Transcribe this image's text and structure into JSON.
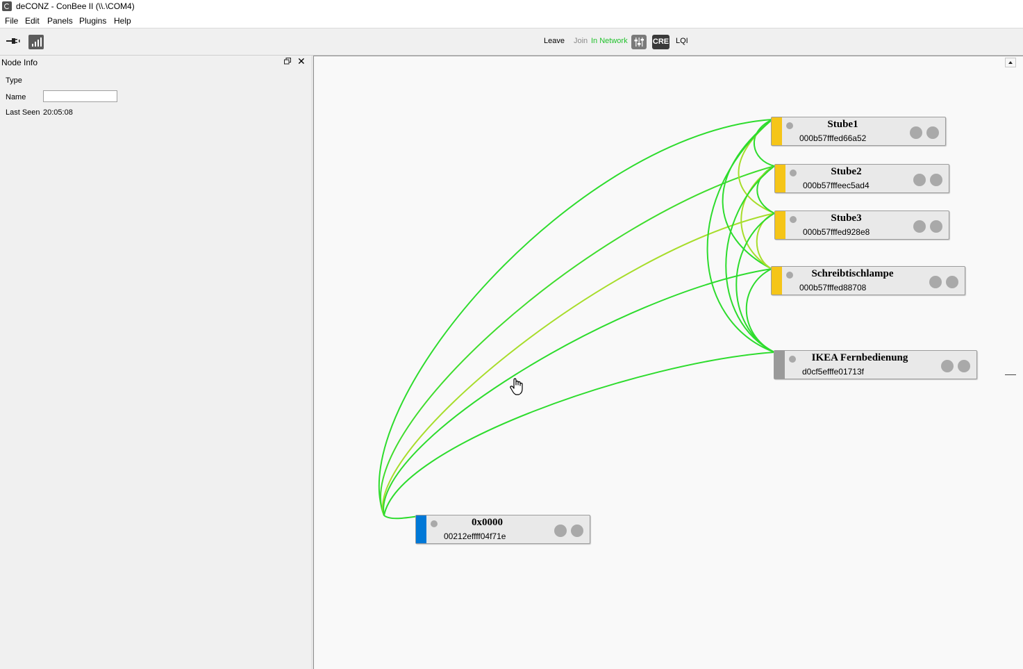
{
  "window": {
    "title": "deCONZ - ConBee II (\\\\.\\COM4)"
  },
  "menu": {
    "file": "File",
    "edit": "Edit",
    "panels": "Panels",
    "plugins": "Plugins",
    "help": "Help"
  },
  "toolbar": {
    "leave": "Leave",
    "join": "Join",
    "in_network": "In Network",
    "cre": "CRE",
    "lqi": "LQI",
    "icons": [
      "plug-icon",
      "signal-icon",
      "sliders-icon"
    ]
  },
  "node_info": {
    "title": "Node Info",
    "type_label": "Type",
    "name_label": "Name",
    "name_value": "",
    "last_seen_label": "Last Seen",
    "last_seen_value": "20:05:08"
  },
  "colors": {
    "router": "#f5c518",
    "coordinator": "#0078d7",
    "end_device": "#9a9a9a",
    "link_strong": "#2ddc2d",
    "link_medium": "#a7dd2a",
    "in_network": "#1fc12a"
  },
  "nodes": [
    {
      "name": "Stube1",
      "mac": "000b57fffed66a52",
      "kind": "router"
    },
    {
      "name": "Stube2",
      "mac": "000b57fffeec5ad4",
      "kind": "router"
    },
    {
      "name": "Stube3",
      "mac": "000b57fffed928e8",
      "kind": "router"
    },
    {
      "name": "Schreibtischlampe",
      "mac": "000b57fffed88708",
      "kind": "router"
    },
    {
      "name": "IKEA Fernbedienung",
      "mac": "d0cf5efffe01713f",
      "kind": "end_device"
    },
    {
      "name": "0x0000",
      "mac": "00212effff04f71e",
      "kind": "coordinator"
    }
  ]
}
